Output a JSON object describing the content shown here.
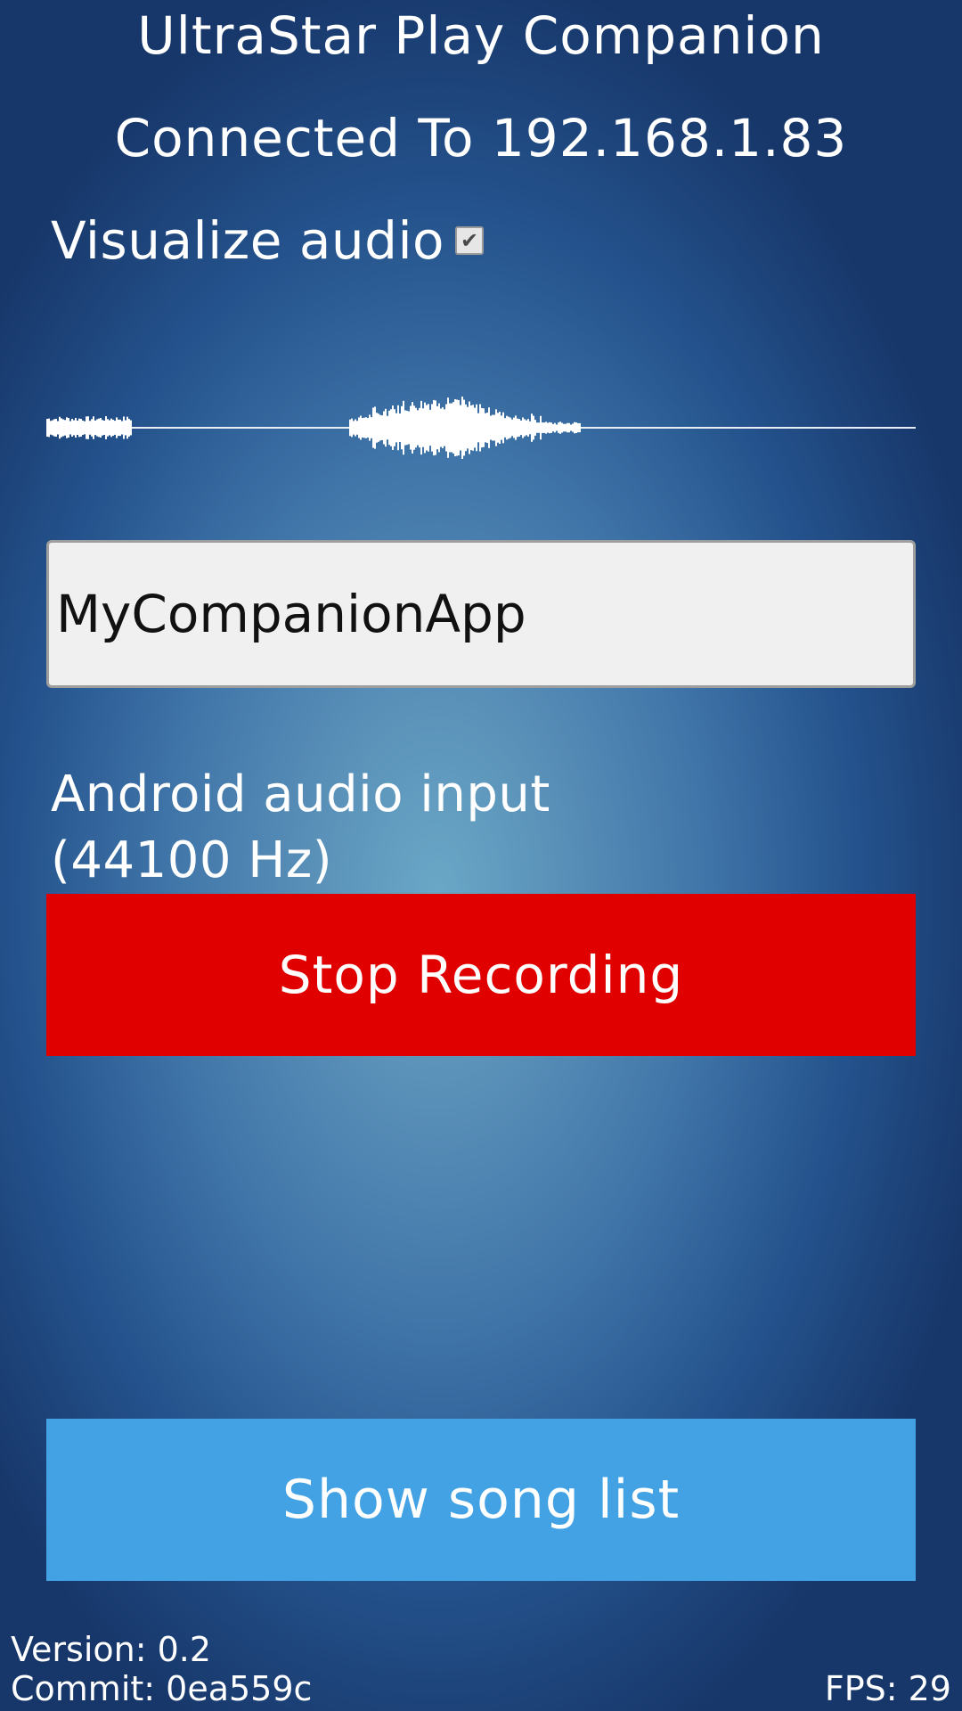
{
  "app": {
    "title": "UltraStar Play Companion",
    "connection_status": "Connected To 192.168.1.83"
  },
  "visualize_audio": {
    "label": "Visualize audio",
    "checked": true
  },
  "player_name_input": {
    "value": "MyCompanionApp"
  },
  "audio_input": {
    "label": "Android audio input\n(44100 Hz)"
  },
  "recording_button": {
    "label": "Stop Recording",
    "color": "#e00000"
  },
  "song_list_button": {
    "label": "Show song list",
    "color": "#42a2e4"
  },
  "footer": {
    "version": "Version: 0.2",
    "commit": "Commit: 0ea559c",
    "fps": "FPS: 29"
  }
}
